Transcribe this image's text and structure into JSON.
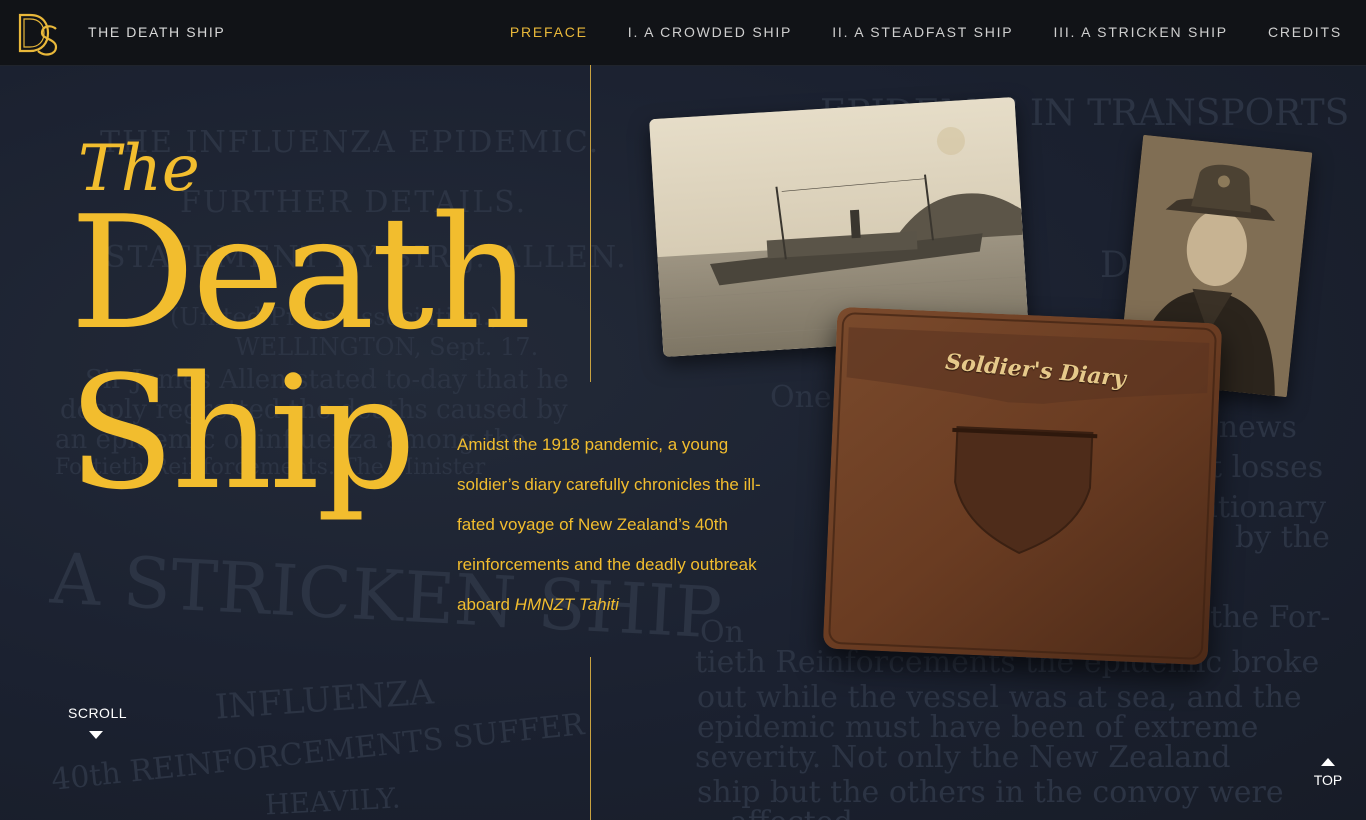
{
  "header": {
    "site_title": "THE DEATH SHIP",
    "logo_alt": "DS",
    "nav": [
      {
        "label": "PREFACE",
        "active": true
      },
      {
        "label": "I. A CROWDED SHIP",
        "active": false
      },
      {
        "label": "II. A STEADFAST SHIP",
        "active": false
      },
      {
        "label": "III. A STRICKEN SHIP",
        "active": false
      },
      {
        "label": "CREDITS",
        "active": false
      }
    ]
  },
  "hero": {
    "title_the": "The",
    "title_death": "Death",
    "title_ship": "Ship",
    "intro_text": "Amidst the 1918 pandemic, a young soldier’s diary carefully chronicles the ill-fated voyage of New Zealand’s 40th reinforcements and the deadly outbreak aboard ",
    "intro_ship_name": "HMNZT Tahiti"
  },
  "diary_cover_text": "Soldier's Diary",
  "background_news": [
    "THE INFLUENZA EPIDEMIC.",
    "FURTHER DETAILS.",
    "STATEMENT BY SIR J. ALLEN.",
    "(United Press Association.)",
    "WELLINGTON, Sept. 17.",
    "Sir James Allen stated to-day that he",
    "deeply regretted the deaths caused by",
    "an epidemic of influenza among the",
    "Fortieth Reinforcements. The Minister",
    "A STRICKEN SHIP",
    "INFLUENZA",
    "40th REINFORCEMENTS SUFFER",
    "HEAVILY.",
    "EPIDEMIC IN TRANSPORTS",
    "DEATHS",
    "One",
    "of news",
    "t losses",
    "ationary",
    "by the",
    "the For-",
    "On",
    "tieth Reinforcements the epidemic broke",
    "out while the vessel was at sea, and the",
    "epidemic must have been of extreme",
    "severity. Not only the New Zealand",
    "ship but the others in the convoy were",
    "affected"
  ],
  "controls": {
    "scroll_label": "SCROLL",
    "top_label": "TOP"
  },
  "colors": {
    "accent": "#f2bd2e",
    "nav_bg": "#111317",
    "page_bg": "#1a1f2b",
    "divider": "#c9a240"
  }
}
